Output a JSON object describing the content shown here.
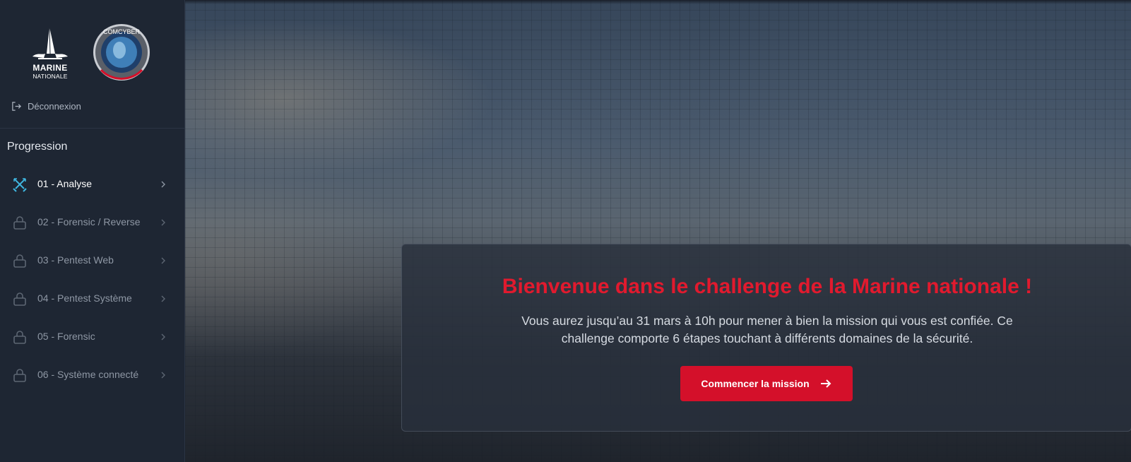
{
  "sidebar": {
    "logo_marine": {
      "line1": "MARINE",
      "line2": "NATIONALE"
    },
    "logo_comcyber": {
      "top_text": "COMCYBER",
      "ring_text": "COMMANDEMENT DE LA CYBERDÉFENSE"
    },
    "logout_label": "Déconnexion",
    "section_title": "Progression",
    "items": [
      {
        "label": "01 - Analyse",
        "icon": "crossed-swords-icon",
        "state": "active"
      },
      {
        "label": "02 - Forensic / Reverse",
        "icon": "lock-icon",
        "state": "locked"
      },
      {
        "label": "03 - Pentest Web",
        "icon": "lock-icon",
        "state": "locked"
      },
      {
        "label": "04 - Pentest Système",
        "icon": "lock-icon",
        "state": "locked"
      },
      {
        "label": "05 - Forensic",
        "icon": "lock-icon",
        "state": "locked"
      },
      {
        "label": "06 - Système connecté",
        "icon": "lock-icon",
        "state": "locked"
      }
    ]
  },
  "main": {
    "welcome_title": "Bienvenue dans le challenge de la Marine nationale !",
    "welcome_text": "Vous aurez jusqu’au 31 mars à 10h pour mener à bien la mission qui vous est confiée. Ce challenge comporte 6 étapes touchant à différents domaines de la sécurité.",
    "start_button_label": "Commencer la mission"
  },
  "colors": {
    "sidebar_bg": "#1e2633",
    "accent_red": "#d4102a",
    "title_red": "#e11a2e",
    "active_icon": "#3fb6e0"
  }
}
